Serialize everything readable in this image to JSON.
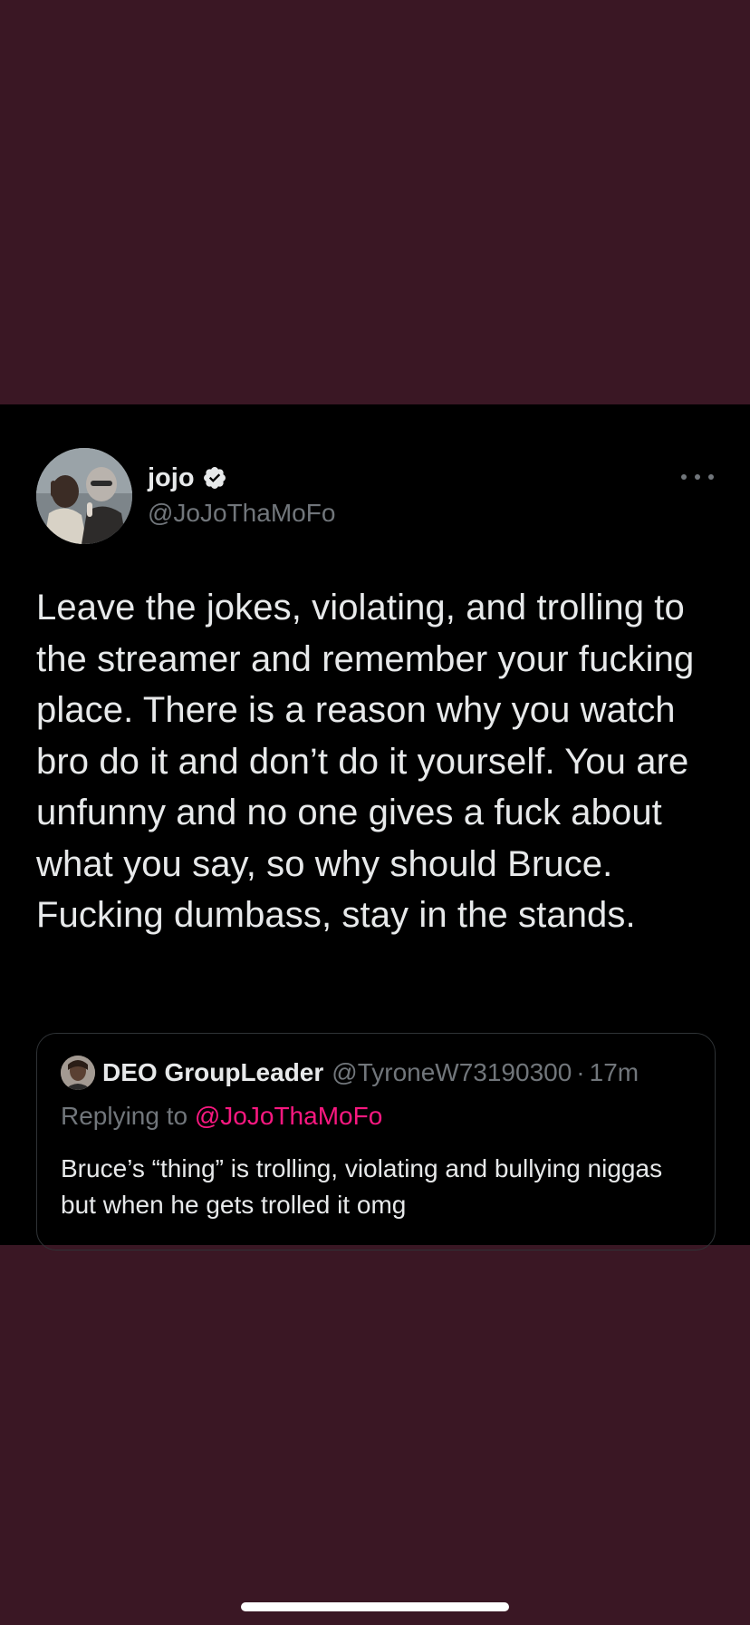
{
  "tweet": {
    "author": {
      "display_name": "jojo",
      "handle": "@JoJoThaMoFo",
      "verified_icon": "verified-badge-icon",
      "avatar": "avatar-photo"
    },
    "more_icon": "ellipsis-icon",
    "text": "Leave the jokes, violating, and trolling to the streamer and remember your fucking place. There is a reason why you watch bro do it and don’t do it yourself. You are unfunny and no one gives a fuck about what you say, so why should Bruce. Fucking dumbass, stay in the stands."
  },
  "quoted_tweet": {
    "display_name": "DEO GroupLeader",
    "handle": "@TyroneW73190300",
    "separator": "·",
    "time": "17m",
    "replying_prefix": "Replying to ",
    "replying_to": "@JoJoThaMoFo",
    "text": "Bruce’s “thing” is trolling, violating and bullying niggas but when he gets trolled it omg"
  },
  "colors": {
    "page_background": "#3a1724",
    "card_background": "#000000",
    "primary_text": "#e7e9ea",
    "secondary_text": "#71767b",
    "mention_accent": "#f91880"
  }
}
